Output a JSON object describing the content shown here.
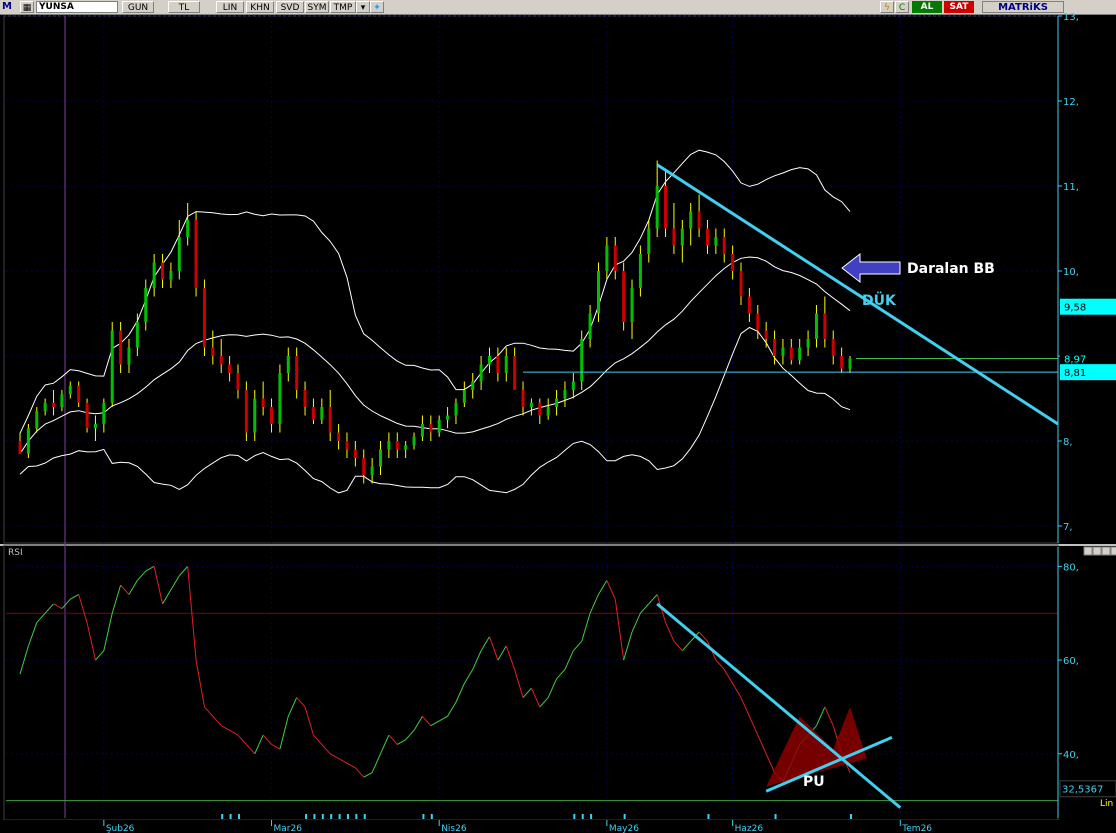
{
  "toolbar": {
    "logo": "M",
    "symbol": "YUNSA",
    "buttons": [
      "GUN",
      "TL",
      "LIN",
      "KHN",
      "SVD",
      "SYM",
      "TMP"
    ],
    "al_label": "AL",
    "sat_label": "SAT",
    "brand": "MATRiKS",
    "icons": [
      "lightning-icon",
      "refresh-icon",
      "twitter-icon",
      "dropdown-icon"
    ]
  },
  "colors": {
    "up_candle": "#00c000",
    "down_candle": "#cc0000",
    "wick": "#ffff00",
    "bollinger": "#ffffff",
    "trendline": "#40d0f0",
    "grid": "#00005a",
    "axis_label": "#40d0f0",
    "rsi_level": "#8b0000",
    "arrow": "#4040c0",
    "rsi_fill": "#8b0000"
  },
  "annotations": {
    "arrow_text": "Daralan BB",
    "trend_text": "DÜK",
    "rsi_text": "PU"
  },
  "chart_data": [
    {
      "type": "candlestick",
      "title": "",
      "ylim": [
        6.8,
        13.0
      ],
      "y_ticks": [
        "13,",
        "12,",
        "11,",
        "10,",
        "9,",
        "8,",
        "7,"
      ],
      "y_tick_values": [
        13,
        12,
        11,
        10,
        9,
        8,
        7
      ],
      "price_tags": [
        {
          "value": 9.58,
          "label": "9,58"
        },
        {
          "value": 8.97,
          "label": "8,97"
        },
        {
          "value": 8.81,
          "label": "8,81"
        }
      ],
      "x_labels": [
        "Şub26",
        "Mar26",
        "Nis26",
        "May26",
        "Haz26",
        "Tem26"
      ],
      "x_label_index": [
        10,
        30,
        50,
        70,
        85,
        105
      ],
      "overlays": [
        "Bollinger Bands (upper, middle, lower)",
        "descending trendline",
        "horizontal support at 8.81"
      ],
      "ohlc": [
        [
          8.0,
          8.1,
          7.9,
          7.85
        ],
        [
          7.85,
          8.2,
          7.8,
          8.15
        ],
        [
          8.15,
          8.4,
          8.1,
          8.35
        ],
        [
          8.35,
          8.5,
          8.3,
          8.45
        ],
        [
          8.45,
          8.6,
          8.3,
          8.4
        ],
        [
          8.4,
          8.6,
          8.35,
          8.55
        ],
        [
          8.55,
          8.7,
          8.5,
          8.65
        ],
        [
          8.65,
          8.7,
          8.4,
          8.45
        ],
        [
          8.45,
          8.5,
          8.1,
          8.15
        ],
        [
          8.15,
          8.3,
          8.0,
          8.2
        ],
        [
          8.2,
          8.5,
          8.1,
          8.45
        ],
        [
          8.45,
          9.4,
          8.4,
          9.3
        ],
        [
          9.3,
          9.4,
          8.8,
          8.9
        ],
        [
          8.9,
          9.2,
          8.8,
          9.1
        ],
        [
          9.1,
          9.5,
          9.0,
          9.4
        ],
        [
          9.4,
          9.9,
          9.3,
          9.8
        ],
        [
          9.8,
          10.2,
          9.7,
          10.1
        ],
        [
          10.1,
          10.2,
          9.8,
          9.9
        ],
        [
          9.9,
          10.1,
          9.8,
          10.0
        ],
        [
          10.0,
          10.6,
          9.9,
          10.4
        ],
        [
          10.4,
          10.8,
          10.3,
          10.6
        ],
        [
          10.6,
          10.7,
          9.7,
          9.8
        ],
        [
          9.8,
          9.9,
          9.0,
          9.1
        ],
        [
          9.1,
          9.3,
          8.9,
          9.0
        ],
        [
          9.0,
          9.2,
          8.8,
          8.9
        ],
        [
          8.9,
          9.0,
          8.7,
          8.8
        ],
        [
          8.8,
          8.9,
          8.5,
          8.6
        ],
        [
          8.6,
          8.7,
          8.0,
          8.1
        ],
        [
          8.1,
          8.6,
          8.0,
          8.5
        ],
        [
          8.5,
          8.7,
          8.3,
          8.4
        ],
        [
          8.4,
          8.5,
          8.1,
          8.2
        ],
        [
          8.2,
          8.9,
          8.1,
          8.8
        ],
        [
          8.8,
          9.1,
          8.7,
          9.0
        ],
        [
          9.0,
          9.1,
          8.5,
          8.6
        ],
        [
          8.6,
          8.7,
          8.3,
          8.4
        ],
        [
          8.4,
          8.5,
          8.2,
          8.25
        ],
        [
          8.25,
          8.5,
          8.2,
          8.4
        ],
        [
          8.4,
          8.6,
          8.0,
          8.1
        ],
        [
          8.1,
          8.2,
          7.9,
          8.0
        ],
        [
          8.0,
          8.1,
          7.8,
          7.9
        ],
        [
          7.9,
          8.0,
          7.7,
          7.8
        ],
        [
          7.8,
          7.9,
          7.5,
          7.6
        ],
        [
          7.6,
          7.8,
          7.5,
          7.7
        ],
        [
          7.7,
          8.0,
          7.6,
          7.9
        ],
        [
          7.9,
          8.1,
          7.8,
          8.0
        ],
        [
          8.0,
          8.1,
          7.8,
          7.9
        ],
        [
          7.9,
          8.0,
          7.8,
          7.95
        ],
        [
          7.95,
          8.1,
          7.9,
          8.05
        ],
        [
          8.05,
          8.3,
          8.0,
          8.2
        ],
        [
          8.2,
          8.3,
          8.0,
          8.1
        ],
        [
          8.1,
          8.3,
          8.05,
          8.25
        ],
        [
          8.25,
          8.4,
          8.15,
          8.3
        ],
        [
          8.3,
          8.5,
          8.2,
          8.45
        ],
        [
          8.45,
          8.7,
          8.4,
          8.6
        ],
        [
          8.6,
          8.8,
          8.5,
          8.7
        ],
        [
          8.7,
          9.0,
          8.6,
          8.9
        ],
        [
          8.9,
          9.1,
          8.8,
          9.0
        ],
        [
          9.0,
          9.1,
          8.7,
          8.8
        ],
        [
          8.8,
          9.1,
          8.7,
          9.0
        ],
        [
          9.0,
          9.1,
          8.6,
          8.6
        ],
        [
          8.6,
          8.7,
          8.3,
          8.4
        ],
        [
          8.4,
          8.5,
          8.3,
          8.45
        ],
        [
          8.45,
          8.5,
          8.2,
          8.3
        ],
        [
          8.3,
          8.5,
          8.25,
          8.4
        ],
        [
          8.4,
          8.6,
          8.3,
          8.5
        ],
        [
          8.5,
          8.7,
          8.4,
          8.6
        ],
        [
          8.6,
          8.8,
          8.5,
          8.7
        ],
        [
          8.7,
          9.3,
          8.6,
          9.2
        ],
        [
          9.2,
          9.6,
          9.1,
          9.5
        ],
        [
          9.5,
          10.1,
          9.4,
          10.0
        ],
        [
          10.0,
          10.4,
          9.9,
          10.3
        ],
        [
          10.3,
          10.4,
          9.9,
          10.0
        ],
        [
          10.0,
          10.1,
          9.3,
          9.4
        ],
        [
          9.4,
          9.9,
          9.2,
          9.8
        ],
        [
          9.8,
          10.3,
          9.7,
          10.2
        ],
        [
          10.2,
          10.6,
          10.1,
          10.5
        ],
        [
          10.5,
          11.3,
          10.4,
          11.0
        ],
        [
          11.0,
          11.2,
          10.4,
          10.5
        ],
        [
          10.5,
          10.8,
          10.2,
          10.3
        ],
        [
          10.3,
          10.6,
          10.1,
          10.5
        ],
        [
          10.5,
          10.8,
          10.3,
          10.7
        ],
        [
          10.7,
          10.9,
          10.4,
          10.5
        ],
        [
          10.5,
          10.6,
          10.2,
          10.3
        ],
        [
          10.3,
          10.5,
          10.2,
          10.4
        ],
        [
          10.4,
          10.5,
          10.1,
          10.2
        ],
        [
          10.2,
          10.3,
          9.9,
          10.0
        ],
        [
          10.0,
          10.1,
          9.6,
          9.7
        ],
        [
          9.7,
          9.8,
          9.4,
          9.5
        ],
        [
          9.5,
          9.6,
          9.2,
          9.3
        ],
        [
          9.3,
          9.4,
          9.1,
          9.2
        ],
        [
          9.2,
          9.3,
          8.9,
          9.0
        ],
        [
          9.0,
          9.2,
          8.9,
          9.1
        ],
        [
          9.1,
          9.2,
          8.9,
          8.95
        ],
        [
          8.95,
          9.2,
          8.9,
          9.1
        ],
        [
          9.1,
          9.3,
          9.0,
          9.2
        ],
        [
          9.2,
          9.6,
          9.1,
          9.5
        ],
        [
          9.5,
          9.7,
          9.1,
          9.2
        ],
        [
          9.2,
          9.3,
          8.9,
          9.0
        ],
        [
          9.0,
          9.1,
          8.8,
          8.85
        ],
        [
          8.85,
          9.0,
          8.8,
          8.97
        ]
      ]
    },
    {
      "type": "line",
      "title": "RSI",
      "ylim": [
        28,
        82
      ],
      "y_ticks": [
        "80,",
        "60,",
        "40,"
      ],
      "y_tick_values": [
        80,
        60,
        40
      ],
      "value_tag": {
        "value": 32.5367,
        "label": "32,5367"
      },
      "levels": [
        70,
        30
      ],
      "scale_label": "Lin",
      "values": [
        57,
        63,
        68,
        70,
        72,
        71,
        73,
        74,
        68,
        60,
        62,
        70,
        76,
        74,
        77,
        79,
        80,
        72,
        75,
        78,
        80,
        60,
        50,
        48,
        46,
        45,
        44,
        42,
        40,
        44,
        42,
        41,
        48,
        52,
        50,
        44,
        42,
        40,
        39,
        38,
        37,
        35,
        36,
        40,
        44,
        42,
        43,
        45,
        48,
        46,
        47,
        48,
        51,
        55,
        58,
        62,
        65,
        60,
        63,
        58,
        52,
        54,
        50,
        52,
        56,
        58,
        62,
        64,
        70,
        74,
        77,
        73,
        60,
        66,
        70,
        72,
        74,
        68,
        64,
        62,
        64,
        66,
        64,
        60,
        58,
        55,
        52,
        48,
        44,
        40,
        36,
        34,
        38,
        42,
        44,
        46,
        50,
        46,
        40,
        36
      ]
    }
  ]
}
